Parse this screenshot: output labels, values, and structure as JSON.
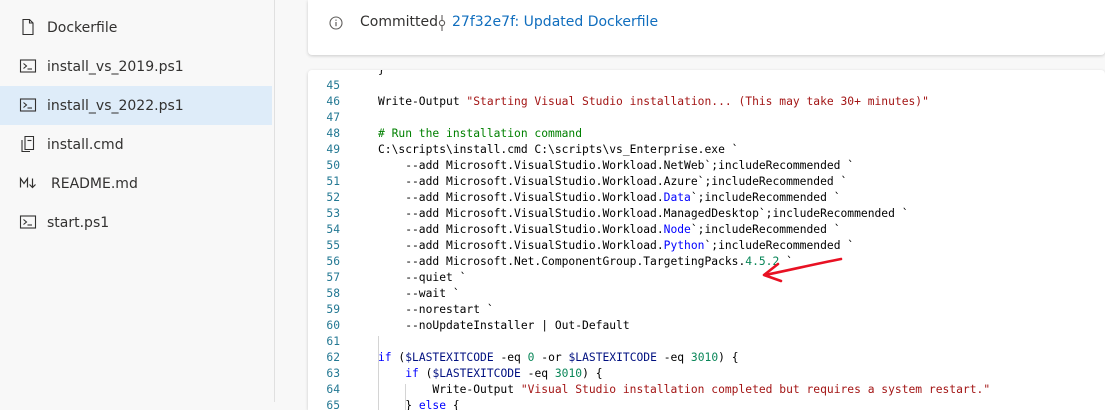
{
  "sidebar": {
    "files": [
      {
        "name": "Dockerfile",
        "icon": "file-icon",
        "selected": false
      },
      {
        "name": "install_vs_2019.ps1",
        "icon": "powershell-icon",
        "selected": false
      },
      {
        "name": "install_vs_2022.ps1",
        "icon": "powershell-icon",
        "selected": true
      },
      {
        "name": "install.cmd",
        "icon": "cmd-file-icon",
        "selected": false
      },
      {
        "name": "README.md",
        "icon": "markdown-icon",
        "selected": false
      },
      {
        "name": "start.ps1",
        "icon": "powershell-icon",
        "selected": false
      }
    ]
  },
  "banner": {
    "status": "Committed",
    "commit_link": "27f32e7f: Updated Dockerfile",
    "info_icon": "info-icon",
    "commit_icon": "commit-icon"
  },
  "editor": {
    "lines": [
      {
        "n": "",
        "parts": [
          [
            "}",
            ""
          ]
        ]
      },
      {
        "n": "45",
        "parts": []
      },
      {
        "n": "46",
        "parts": [
          [
            "Write-Output ",
            ""
          ],
          [
            "\"Starting Visual Studio installation... (This may take 30+ minutes)\"",
            "s"
          ]
        ]
      },
      {
        "n": "47",
        "parts": []
      },
      {
        "n": "48",
        "parts": [
          [
            "# Run the installation command",
            "c"
          ]
        ]
      },
      {
        "n": "49",
        "parts": [
          [
            "C:\\scripts\\install.cmd C:\\scripts\\vs_Enterprise.exe `",
            ""
          ]
        ]
      },
      {
        "n": "50",
        "parts": [
          [
            "    --add Microsoft.VisualStudio.Workload.NetWeb`;includeRecommended `",
            ""
          ]
        ]
      },
      {
        "n": "51",
        "parts": [
          [
            "    --add Microsoft.VisualStudio.Workload.Azure`;includeRecommended `",
            ""
          ]
        ]
      },
      {
        "n": "52",
        "parts": [
          [
            "    --add Microsoft.VisualStudio.Workload.",
            ""
          ],
          [
            "Data",
            "k"
          ],
          [
            "`;includeRecommended `",
            ""
          ]
        ]
      },
      {
        "n": "53",
        "parts": [
          [
            "    --add Microsoft.VisualStudio.Workload.ManagedDesktop`;includeRecommended `",
            ""
          ]
        ]
      },
      {
        "n": "54",
        "parts": [
          [
            "    --add Microsoft.VisualStudio.Workload.",
            ""
          ],
          [
            "Node",
            "k"
          ],
          [
            "`;includeRecommended `",
            ""
          ]
        ]
      },
      {
        "n": "55",
        "parts": [
          [
            "    --add Microsoft.VisualStudio.Workload.",
            ""
          ],
          [
            "Python",
            "k"
          ],
          [
            "`;includeRecommended `",
            ""
          ]
        ]
      },
      {
        "n": "56",
        "parts": [
          [
            "    --add Microsoft.Net.ComponentGroup.TargetingPacks.",
            ""
          ],
          [
            "4.5.2",
            "n"
          ],
          [
            " `",
            ""
          ]
        ]
      },
      {
        "n": "57",
        "parts": [
          [
            "    --quiet `",
            ""
          ]
        ]
      },
      {
        "n": "58",
        "parts": [
          [
            "    --wait `",
            ""
          ]
        ]
      },
      {
        "n": "59",
        "parts": [
          [
            "    --norestart `",
            ""
          ]
        ]
      },
      {
        "n": "60",
        "parts": [
          [
            "    --noUpdateInstaller | Out-Default",
            ""
          ]
        ]
      },
      {
        "n": "61",
        "parts": []
      },
      {
        "n": "62",
        "parts": [
          [
            "if",
            "k"
          ],
          [
            " (",
            ""
          ],
          [
            "$LASTEXITCODE",
            "v"
          ],
          [
            " -eq ",
            ""
          ],
          [
            "0",
            "n"
          ],
          [
            " -or ",
            ""
          ],
          [
            "$LASTEXITCODE",
            "v"
          ],
          [
            " -eq ",
            ""
          ],
          [
            "3010",
            "n"
          ],
          [
            ") {",
            ""
          ]
        ]
      },
      {
        "n": "63",
        "parts": [
          [
            "    ",
            ""
          ],
          [
            "if",
            "k"
          ],
          [
            " (",
            ""
          ],
          [
            "$LASTEXITCODE",
            "v"
          ],
          [
            " -eq ",
            ""
          ],
          [
            "3010",
            "n"
          ],
          [
            ") {",
            ""
          ]
        ]
      },
      {
        "n": "64",
        "parts": [
          [
            "        Write-Output ",
            ""
          ],
          [
            "\"Visual Studio installation completed but requires a system restart.\"",
            "s"
          ]
        ]
      },
      {
        "n": "65",
        "parts": [
          [
            "    } ",
            ""
          ],
          [
            "else",
            "k"
          ],
          [
            " {",
            ""
          ]
        ]
      }
    ]
  },
  "annotation": {
    "type": "red-arrow",
    "color": "#e81123",
    "points_to_line": "56"
  }
}
